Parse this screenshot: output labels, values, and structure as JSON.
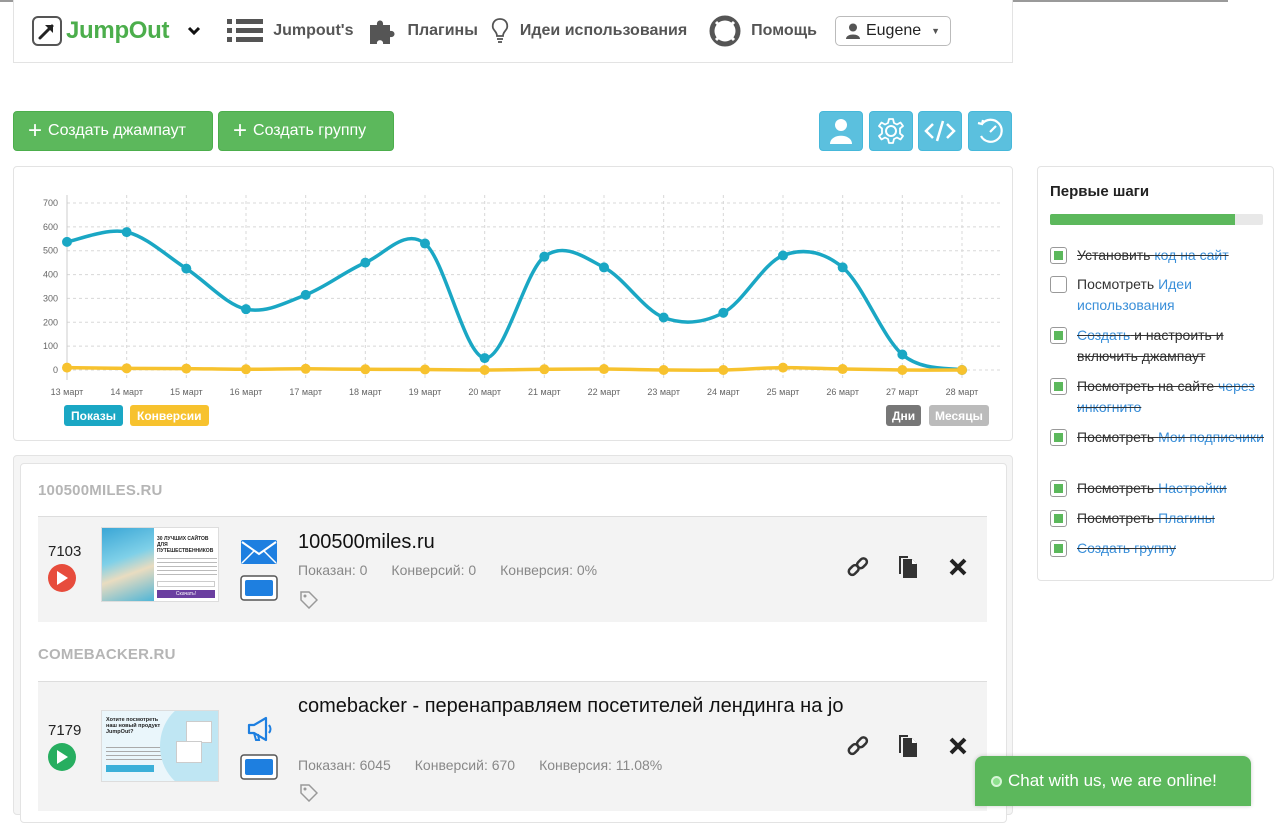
{
  "header": {
    "brand": "JumpOut",
    "nav": [
      {
        "label": "Jumpout's",
        "icon": "list-icon"
      },
      {
        "label": "Плагины",
        "icon": "puzzle-icon"
      },
      {
        "label": "Идеи использования",
        "icon": "lightbulb-icon"
      },
      {
        "label": "Помощь",
        "icon": "lifebuoy-icon"
      }
    ],
    "user": "Eugene"
  },
  "actions": {
    "create_jumpout": "Создать джампаут",
    "create_group": "Создать группу",
    "icon_buttons": [
      "user-icon",
      "gear-icon",
      "code-icon",
      "history-icon"
    ]
  },
  "chart_data": {
    "type": "line",
    "categories": [
      "13 март",
      "14 март",
      "15 март",
      "16 март",
      "17 март",
      "18 март",
      "19 март",
      "20 март",
      "21 март",
      "22 март",
      "23 март",
      "24 март",
      "25 март",
      "26 март",
      "27 март",
      "28 март"
    ],
    "y_ticks": [
      "700",
      "600",
      "500",
      "400",
      "300",
      "200",
      "100",
      "0"
    ],
    "ylim": [
      0,
      700
    ],
    "series": [
      {
        "name": "Показы",
        "color": "#1aa7c4",
        "values": [
          537,
          578,
          425,
          255,
          315,
          450,
          530,
          50,
          475,
          430,
          220,
          240,
          480,
          430,
          65,
          0
        ]
      },
      {
        "name": "Конверсии",
        "color": "#f7c22e",
        "values": [
          10,
          7,
          6,
          3,
          5,
          3,
          2,
          0,
          3,
          4,
          0,
          0,
          10,
          4,
          0,
          0
        ]
      }
    ],
    "grid": true,
    "legend": "bottom-left",
    "range_buttons": [
      "Дни",
      "Месяцы"
    ]
  },
  "groups": [
    {
      "name": "100500MILES.RU",
      "item": {
        "count": "7103",
        "title": "100500miles.ru",
        "shows": "Показан: 0",
        "conversions": "Конверсий: 0",
        "rate": "Конверсия: 0%",
        "state": "stopped",
        "type_icon": "envelope-icon",
        "thumb_heading": "30 ЛУЧШИХ САЙТОВ ДЛЯ ПУТЕШЕСТВЕННИКОВ",
        "thumb_button": "Скачать!"
      }
    },
    {
      "name": "COMEBACKER.RU",
      "item": {
        "count": "7179",
        "title": "comebacker - перенаправляем посетителей лендинга на jo",
        "shows": "Показан: 6045",
        "conversions": "Конверсий: 670",
        "rate": "Конверсия: 11.08%",
        "state": "running",
        "type_icon": "megaphone-icon",
        "thumb_heading": "Хотите посмотреть наш новый продукт JumpOut?"
      }
    }
  ],
  "steps": {
    "title": "Первые шаги",
    "progress": 0.87,
    "items": [
      {
        "done": true,
        "text": "Установить ",
        "link": "код на сайт",
        "after": ""
      },
      {
        "done": false,
        "text": "Посмотреть ",
        "link": "Идеи использования",
        "after": ""
      },
      {
        "done": true,
        "text": "",
        "link": "Создать",
        "after": " и настроить и включить джампаут"
      },
      {
        "done": true,
        "text": "Посмотреть на сайте ",
        "link": "через инкогнито",
        "after": ""
      },
      {
        "done": true,
        "text": "Посмотреть ",
        "link": "Мои подписчики",
        "after": ""
      },
      {
        "done": true,
        "text": "Посмотреть ",
        "link": "Настройки",
        "after": ""
      },
      {
        "done": true,
        "text": "Посмотреть ",
        "link": "Плагины",
        "after": ""
      },
      {
        "done": true,
        "text": "",
        "link": "Создать группу",
        "after": ""
      }
    ]
  },
  "chat": {
    "label": "Chat with us, we are online!"
  }
}
